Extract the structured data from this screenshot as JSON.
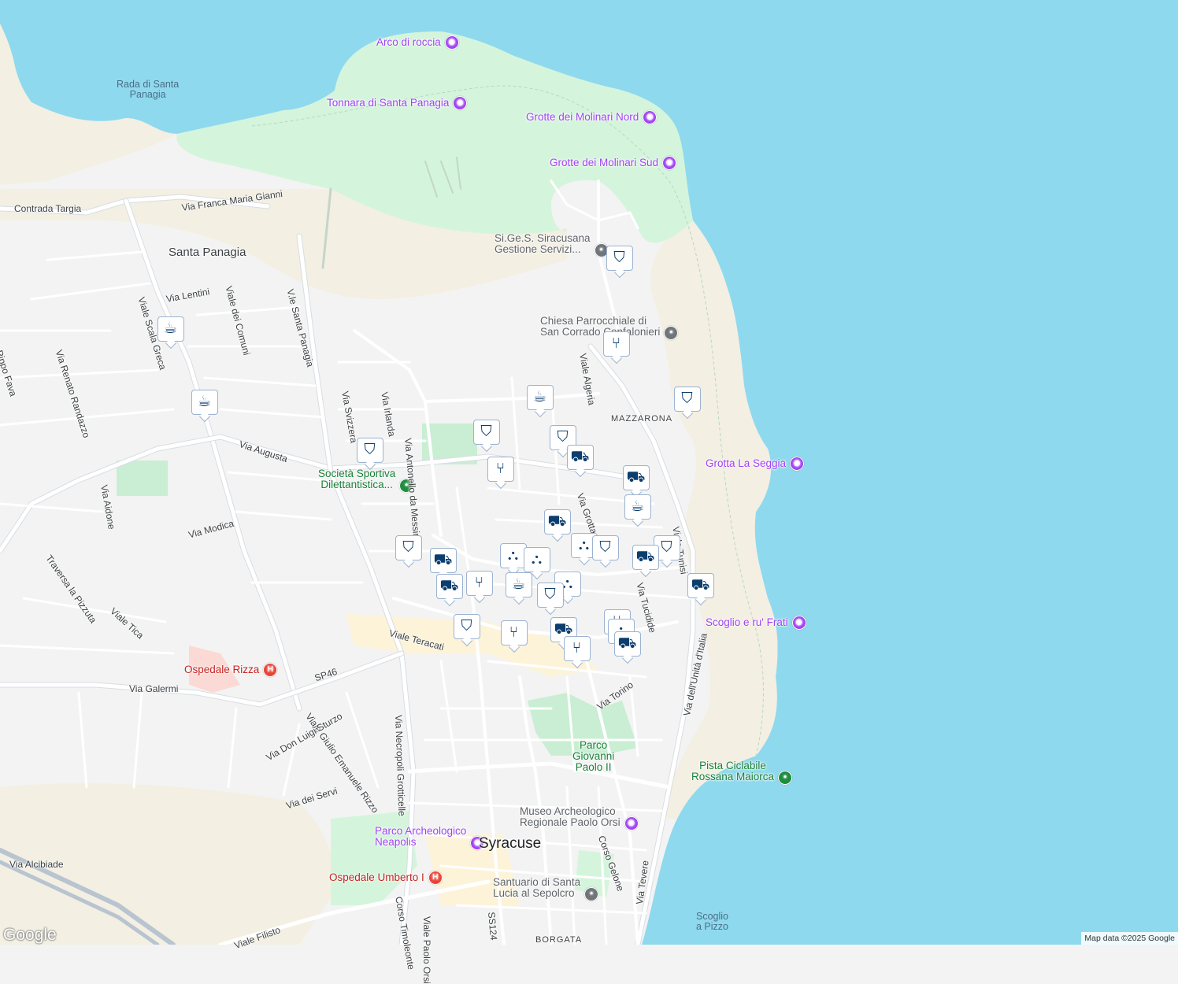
{
  "map": {
    "labels": [
      {
        "text": "Arco di roccia",
        "cls": "poi-p",
        "pin": "p"
      },
      {
        "text": "Tonnara di Santa Panagia",
        "cls": "poi-p",
        "pin": "p"
      },
      {
        "text": "Grotte dei Molinari Nord",
        "cls": "poi-p",
        "pin": "p"
      },
      {
        "text": "Grotte dei Molinari Sud",
        "cls": "poi-p",
        "pin": "p"
      },
      {
        "text": "Si.Ge.S. Siracusana\nGestione Servizi...",
        "cls": "poi-k",
        "pin": "k"
      },
      {
        "text": "Chiesa Parrocchiale di\nSan Corrado Confalonieri",
        "cls": "poi-k",
        "pin": "k"
      },
      {
        "text": "Grotta La Seggia",
        "cls": "poi-p",
        "pin": "p"
      },
      {
        "text": "Scoglio e ru' Frati",
        "cls": "poi-p",
        "pin": "p"
      },
      {
        "text": "Società Sportiva\nDilettantistica...",
        "cls": "poi-g",
        "pin": "g"
      },
      {
        "text": "Ospedale Rizza",
        "cls": "poi-r",
        "pin": "r"
      },
      {
        "text": "Pista Ciclabile\nRossana Maiorca",
        "cls": "poi-g",
        "pin": "g"
      },
      {
        "text": "Museo Archeologico\nRegionale Paolo Orsi",
        "cls": "poi-k",
        "pin": "p"
      },
      {
        "text": "Parco Archeologico\nNeapolis",
        "cls": "poi-p",
        "pin": "p"
      },
      {
        "text": "Ospedale Umberto I",
        "cls": "poi-r",
        "pin": "r"
      },
      {
        "text": "Santuario di Santa\nLucia al Sepolcro",
        "cls": "poi-k",
        "pin": "k"
      },
      {
        "text": "Rada di Santa\nPanagia",
        "cls": "water"
      },
      {
        "text": "Scoglio\na Pizzo",
        "cls": "water"
      },
      {
        "text": "Santa Panagia",
        "cls": "area"
      },
      {
        "text": "MAZZARONA",
        "cls": "small"
      },
      {
        "text": "Syracuse",
        "cls": "city"
      },
      {
        "text": "BORGATA",
        "cls": "small"
      },
      {
        "text": "Parco\nGiovanni\nPaolo II",
        "cls": "poi-g"
      },
      {
        "text": "Contrada Targia",
        "cls": "road"
      },
      {
        "text": "Via Franca Maria Gianni",
        "cls": "road"
      },
      {
        "text": "Via Lentini",
        "cls": "road"
      },
      {
        "text": "Viale dei Comuni",
        "cls": "road"
      },
      {
        "text": "V.le Santa Panagia",
        "cls": "road"
      },
      {
        "text": "Viale Scala Greca",
        "cls": "road"
      },
      {
        "text": "Via Renato Randazzo",
        "cls": "road"
      },
      {
        "text": "Via Pippo Fava",
        "cls": "road"
      },
      {
        "text": "Via Augusta",
        "cls": "road"
      },
      {
        "text": "Via Svizzera",
        "cls": "road"
      },
      {
        "text": "Via Irlanda",
        "cls": "road"
      },
      {
        "text": "Via Antonello da Messina",
        "cls": "road"
      },
      {
        "text": "Via Aidone",
        "cls": "road"
      },
      {
        "text": "Via Modica",
        "cls": "road"
      },
      {
        "text": "Traversa la Pizzuta",
        "cls": "road"
      },
      {
        "text": "Viale Tica",
        "cls": "road"
      },
      {
        "text": "Viale Teracati",
        "cls": "road"
      },
      {
        "text": "SP46",
        "cls": "road"
      },
      {
        "text": "Via Necropoli Grotticelle",
        "cls": "road"
      },
      {
        "text": "Via Galermi",
        "cls": "road"
      },
      {
        "text": "Viale Giulio Emanuele Rizzo",
        "cls": "road"
      },
      {
        "text": "Via Don Luigi Sturzo",
        "cls": "road"
      },
      {
        "text": "Via dei Servi",
        "cls": "road"
      },
      {
        "text": "Viale Algeria",
        "cls": "road"
      },
      {
        "text": "Via Grotta Santa",
        "cls": "road"
      },
      {
        "text": "Viale Tunisi",
        "cls": "road"
      },
      {
        "text": "Via Tucidide",
        "cls": "road"
      },
      {
        "text": "Via dell'Unità d'Italia",
        "cls": "road"
      },
      {
        "text": "Via Torino",
        "cls": "road"
      },
      {
        "text": "Via Tevere",
        "cls": "road"
      },
      {
        "text": "Corso Gelone",
        "cls": "road"
      },
      {
        "text": "Corso Timoleonte",
        "cls": "road"
      },
      {
        "text": "Viale Paolo Orsi",
        "cls": "road"
      },
      {
        "text": "SS124",
        "cls": "road"
      },
      {
        "text": "Viale Filisto",
        "cls": "road"
      },
      {
        "text": "Via Alcibiade",
        "cls": "road"
      }
    ],
    "markers": [
      {
        "type": "education",
        "icon": "education-icon"
      },
      {
        "type": "coffee",
        "icon": "coffee-icon"
      },
      {
        "type": "restaurant",
        "icon": "restaurant-icon"
      },
      {
        "type": "coffee",
        "icon": "coffee-icon"
      },
      {
        "type": "education",
        "icon": "education-icon"
      },
      {
        "type": "coffee",
        "icon": "coffee-icon"
      },
      {
        "type": "education",
        "icon": "education-icon"
      },
      {
        "type": "education",
        "icon": "education-icon"
      },
      {
        "type": "education",
        "icon": "education-icon"
      },
      {
        "type": "shopping",
        "icon": "shopping-cart-icon"
      },
      {
        "type": "restaurant",
        "icon": "restaurant-icon"
      },
      {
        "type": "shopping",
        "icon": "shopping-cart-icon"
      },
      {
        "type": "coffee",
        "icon": "coffee-icon"
      },
      {
        "type": "shopping",
        "icon": "shopping-cart-icon"
      },
      {
        "type": "bag",
        "icon": "shopping-bag-icon"
      },
      {
        "type": "education",
        "icon": "education-icon"
      },
      {
        "type": "education",
        "icon": "education-icon"
      },
      {
        "type": "shopping",
        "icon": "shopping-cart-icon"
      },
      {
        "type": "shopping",
        "icon": "shopping-cart-icon"
      },
      {
        "type": "education",
        "icon": "education-icon"
      },
      {
        "type": "shopping",
        "icon": "shopping-cart-icon"
      },
      {
        "type": "shopping",
        "icon": "shopping-cart-icon"
      },
      {
        "type": "restaurant",
        "icon": "restaurant-icon"
      },
      {
        "type": "bag",
        "icon": "shopping-bag-icon"
      },
      {
        "type": "bag",
        "icon": "shopping-bag-icon"
      },
      {
        "type": "coffee",
        "icon": "coffee-icon"
      },
      {
        "type": "bag",
        "icon": "shopping-bag-icon"
      },
      {
        "type": "education",
        "icon": "education-icon"
      },
      {
        "type": "education",
        "icon": "education-icon"
      },
      {
        "type": "restaurant",
        "icon": "restaurant-icon"
      },
      {
        "type": "shopping",
        "icon": "shopping-cart-icon"
      },
      {
        "type": "restaurant",
        "icon": "restaurant-icon"
      },
      {
        "type": "restaurant",
        "icon": "restaurant-icon"
      },
      {
        "type": "bag",
        "icon": "shopping-bag-icon"
      },
      {
        "type": "shopping",
        "icon": "shopping-cart-icon"
      }
    ],
    "attribution": {
      "logo": "Google",
      "copyright": "Map data ©2025 Google"
    },
    "colors": {
      "sea": "#8fd9ee",
      "land": "#f3f3f3",
      "park": "#d4f5dc",
      "sand": "#f3efe2",
      "road": "#ffffff",
      "roadMajor": "#c9d2dc",
      "marker": "#0b3d6e"
    }
  }
}
